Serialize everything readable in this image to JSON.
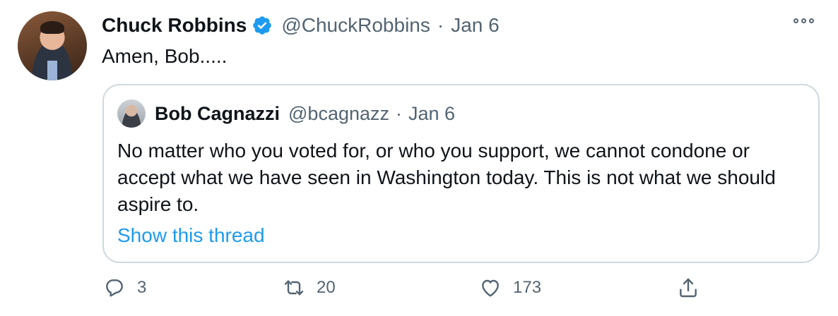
{
  "tweet": {
    "author_name": "Chuck Robbins",
    "author_handle": "@ChuckRobbins",
    "separator": "·",
    "date": "Jan 6",
    "text": "Amen, Bob.....",
    "verified": true
  },
  "quoted_tweet": {
    "author_name": "Bob Cagnazzi",
    "author_handle": "@bcagnazz",
    "separator": "·",
    "date": "Jan 6",
    "text": "No matter who you voted for, or who you support, we cannot condone or accept what we have seen in Washington today. This is not what we should aspire to.",
    "thread_link": "Show this thread"
  },
  "actions": {
    "reply_count": "3",
    "retweet_count": "20",
    "like_count": "173",
    "icons": [
      "reply-icon",
      "retweet-icon",
      "like-icon",
      "share-icon"
    ]
  },
  "colors": {
    "text": "#0f1419",
    "secondary": "#536471",
    "link": "#1d9bf0",
    "border": "#cfd9de",
    "verified": "#1d9bf0"
  }
}
